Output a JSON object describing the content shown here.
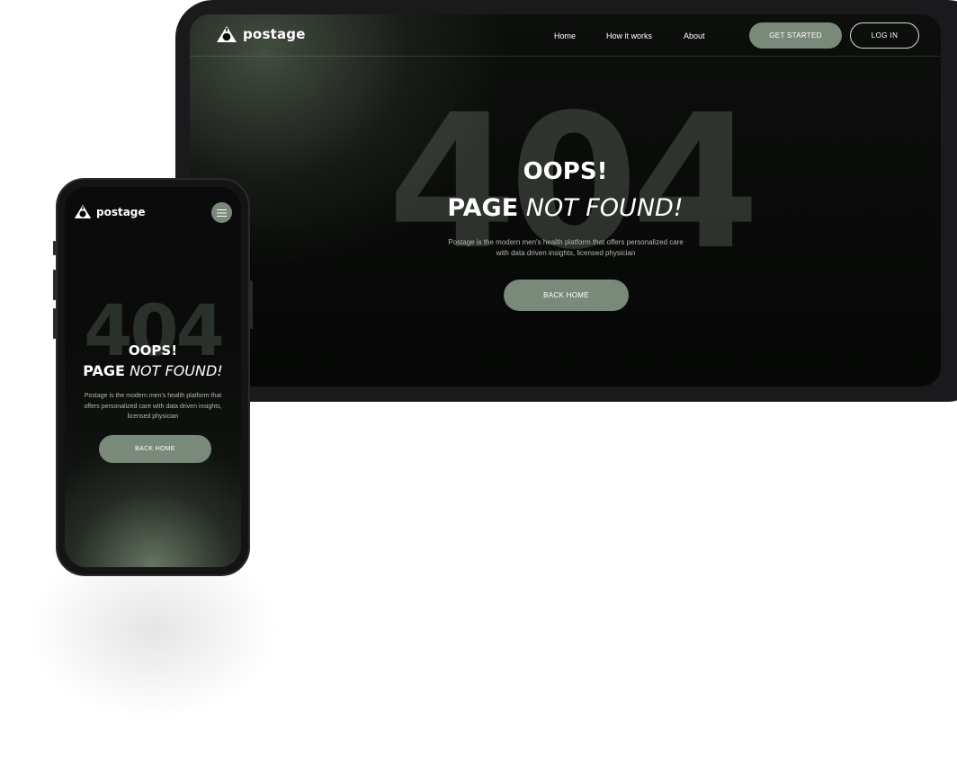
{
  "brand": {
    "name": "postage"
  },
  "colors": {
    "accent": "#7a8a7a",
    "background": "#0a0b0a",
    "frame": "#1a1a1c"
  },
  "desktop": {
    "nav": {
      "links": [
        "Home",
        "How it works",
        "About"
      ],
      "get_started": "GET STARTED",
      "login": "LOG IN"
    },
    "hero": {
      "big_number": "404",
      "oops": "OOPS!",
      "page_word": "PAGE",
      "not_found": "NOT FOUND!",
      "description": "Postage is the modern men's health platform that offers personalized care with data driven insights, licensed physician",
      "button": "BACK HOME"
    }
  },
  "mobile": {
    "menu_icon": "hamburger-icon",
    "hero": {
      "big_number": "404",
      "oops": "OOPS!",
      "page_word": "PAGE",
      "not_found": "NOT FOUND!",
      "description": "Postage is the modern men's health platform that offers personalized care with data driven insights, licensed physician",
      "button": "BACK HOME"
    }
  }
}
